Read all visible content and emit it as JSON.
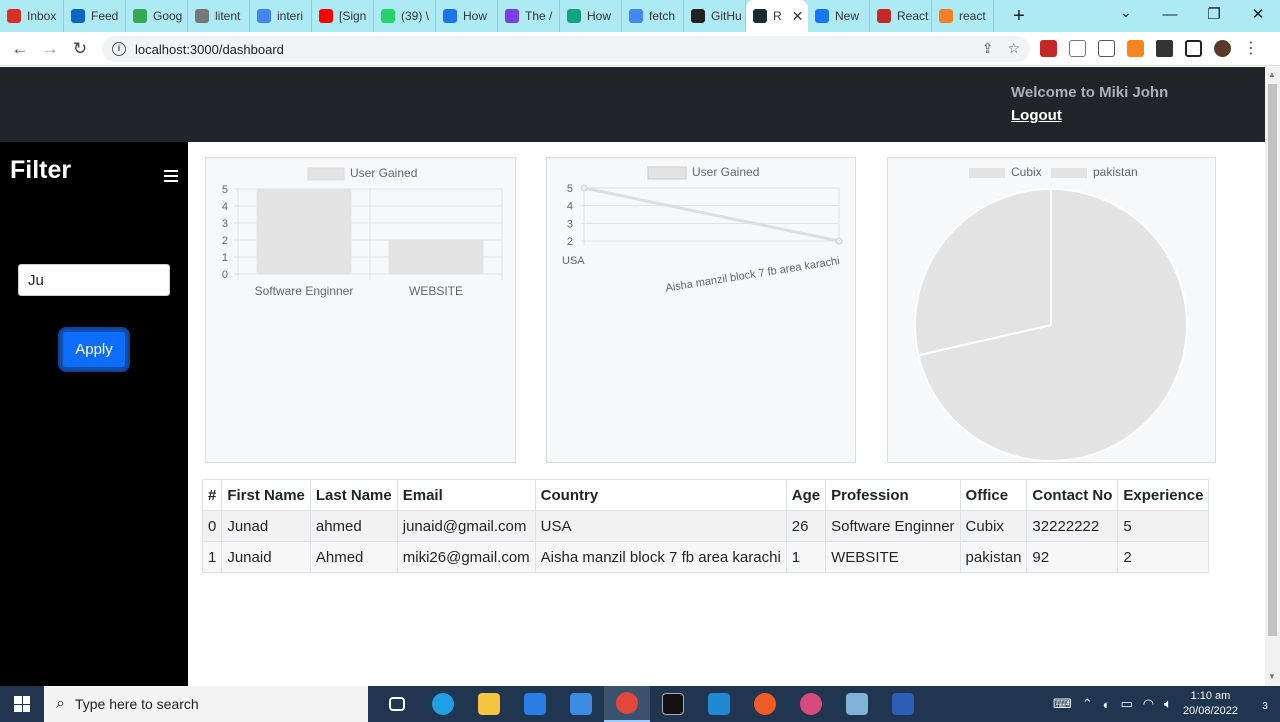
{
  "browser": {
    "tabs": [
      {
        "label": "Inbox",
        "color": "#d93025"
      },
      {
        "label": "Feed",
        "color": "#0a66c2"
      },
      {
        "label": "Goog",
        "color": "#34a853"
      },
      {
        "label": "litent",
        "color": "#777777"
      },
      {
        "label": "interi",
        "color": "#4285f4"
      },
      {
        "label": "[Sign",
        "color": "#ff0000"
      },
      {
        "label": "(39) \\",
        "color": "#25d366"
      },
      {
        "label": "How",
        "color": "#1a73e8"
      },
      {
        "label": "The /",
        "color": "#7b3fe4"
      },
      {
        "label": "How",
        "color": "#12a37a"
      },
      {
        "label": "fetch",
        "color": "#4285f4"
      },
      {
        "label": "GitHu",
        "color": "#222222"
      },
      {
        "label": "R",
        "color": "#1c2b33",
        "active": true
      },
      {
        "label": "New",
        "color": "#1877f2"
      },
      {
        "label": "React",
        "color": "#c62828"
      },
      {
        "label": "react",
        "color": "#f48024"
      }
    ],
    "url": "localhost:3000/dashboard"
  },
  "header": {
    "welcome": "Welcome to Miki John",
    "logout": "Logout"
  },
  "sidebar": {
    "title": "Filter",
    "filter_value": "Ju",
    "apply_label": "Apply"
  },
  "charts": {
    "bar_legend": "User Gained",
    "line_legend": "User Gained",
    "pie_legend": [
      "Cubix",
      "pakistan"
    ]
  },
  "chart_data": [
    {
      "type": "bar",
      "categories": [
        "Software Enginner",
        "WEBSITE"
      ],
      "series": [
        {
          "name": "User Gained",
          "values": [
            5,
            2
          ]
        }
      ],
      "ylim": [
        0,
        5
      ],
      "grid": true,
      "legend_position": "top"
    },
    {
      "type": "line",
      "categories": [
        "USA",
        "Aisha manzil block 7 fb area karachi"
      ],
      "series": [
        {
          "name": "User Gained",
          "values": [
            5,
            2
          ]
        }
      ],
      "ylim": [
        2,
        5
      ],
      "grid": true,
      "legend_position": "top"
    },
    {
      "type": "pie",
      "categories": [
        "Cubix",
        "pakistan"
      ],
      "values": [
        5,
        2
      ],
      "legend_position": "top"
    }
  ],
  "table": {
    "headers": [
      "#",
      "First Name",
      "Last Name",
      "Email",
      "Country",
      "Age",
      "Profession",
      "Office",
      "Contact No",
      "Experience"
    ],
    "rows": [
      [
        "0",
        "Junad",
        "ahmed",
        "junaid@gmail.com",
        "USA",
        "26",
        "Software Enginner",
        "Cubix",
        "32222222",
        "5"
      ],
      [
        "1",
        "Junaid",
        "Ahmed",
        "miki26@gmail.com",
        "Aisha manzil block 7 fb area karachi",
        "1",
        "WEBSITE",
        "pakistan",
        "92",
        "2"
      ]
    ]
  },
  "taskbar": {
    "search_placeholder": "Type here to search",
    "time": "1:10 am",
    "date": "20/08/2022",
    "notification_count": "3"
  },
  "colors": {
    "header_bg": "#212529",
    "sidebar_bg": "#000000",
    "apply_bg": "#0d6efd",
    "chart_fill": "#e3e3e3"
  }
}
